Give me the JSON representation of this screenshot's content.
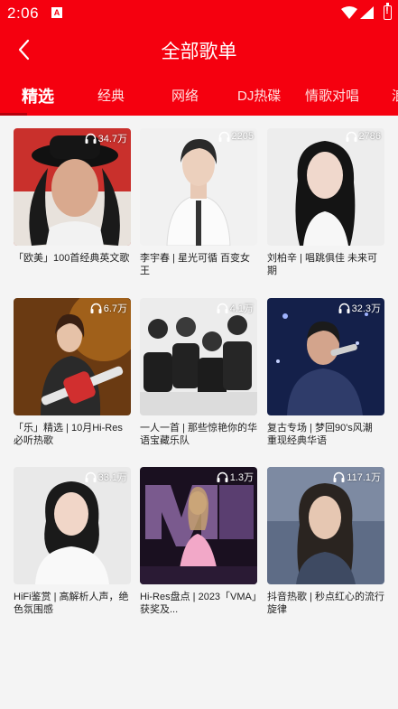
{
  "status_bar": {
    "time": "2:06",
    "sim_label": "A"
  },
  "header": {
    "title": "全部歌单"
  },
  "tabs": [
    {
      "label": "精选"
    },
    {
      "label": "经典"
    },
    {
      "label": "网络"
    },
    {
      "label": "DJ热碟"
    },
    {
      "label": "情歌对唱"
    },
    {
      "label": "浪"
    }
  ],
  "playlists": [
    {
      "plays": "34.7万",
      "title": "「欧美」100首经典英文歌",
      "icon": "headphones-icon"
    },
    {
      "plays": "2205",
      "title": "李宇春 | 星光可循 百变女王",
      "icon": "headphones-icon"
    },
    {
      "plays": "2786",
      "title": "刘柏辛 | 唱跳俱佳 未来可期",
      "icon": "headphones-icon"
    },
    {
      "plays": "6.7万",
      "title": "「乐」精选 | 10月Hi-Res必听热歌",
      "icon": "headphones-icon"
    },
    {
      "plays": "4.1万",
      "title": "一人一首 | 那些惊艳你的华语宝藏乐队",
      "icon": "headphones-icon"
    },
    {
      "plays": "32.3万",
      "title": "复古专场 | 梦回90's风潮 重现经典华语",
      "icon": "headphones-icon"
    },
    {
      "plays": "33.1万",
      "title": "HiFi鉴赏 | 高解析人声，绝色氛围感",
      "icon": "headphones-icon"
    },
    {
      "plays": "1.3万",
      "title": "Hi-Res盘点 | 2023「VMA」获奖及...",
      "icon": "headphones-icon"
    },
    {
      "plays": "117.1万",
      "title": "抖音热歌 | 秒点红心的流行旋律",
      "icon": "headphones-icon"
    }
  ],
  "colors": {
    "header_bg": "#f5000f",
    "page_bg": "#f4f4f4",
    "text": "#222222"
  }
}
